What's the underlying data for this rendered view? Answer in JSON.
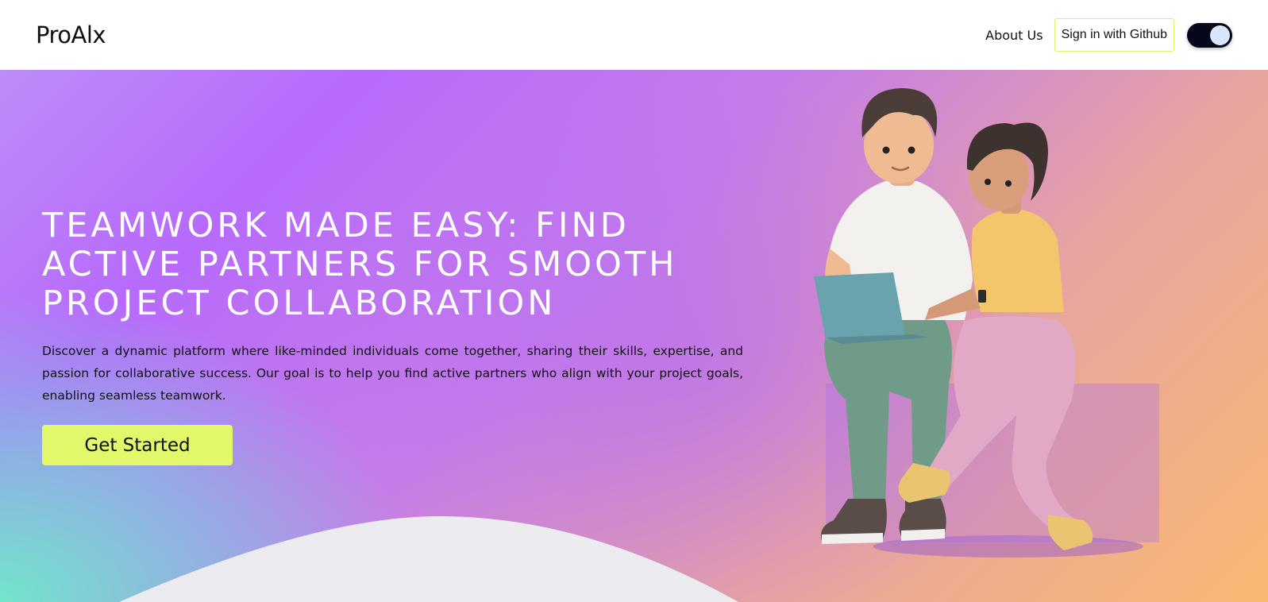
{
  "brand": {
    "logo": "ProAlx"
  },
  "nav": {
    "about_label": "About Us",
    "github_label": "Sign in with Github",
    "theme_toggle": {
      "state": "on"
    }
  },
  "hero": {
    "title": "TEAMWORK MADE EASY: FIND ACTIVE PARTNERS FOR SMOOTH PROJECT COLLABORATION",
    "description": "Discover a dynamic platform where like-minded individuals come together, sharing their skills, expertise, and passion for collaborative success. Our goal is to help you find active partners who align with your project goals, enabling seamless teamwork.",
    "cta_label": "Get Started"
  },
  "colors": {
    "accent": "#e2f76a",
    "gradient_start": "#b76afc",
    "gradient_end": "#fbb872",
    "gradient_corner": "#6eebc8",
    "wave": "#ececf0",
    "toggle_bg": "#06071a"
  }
}
